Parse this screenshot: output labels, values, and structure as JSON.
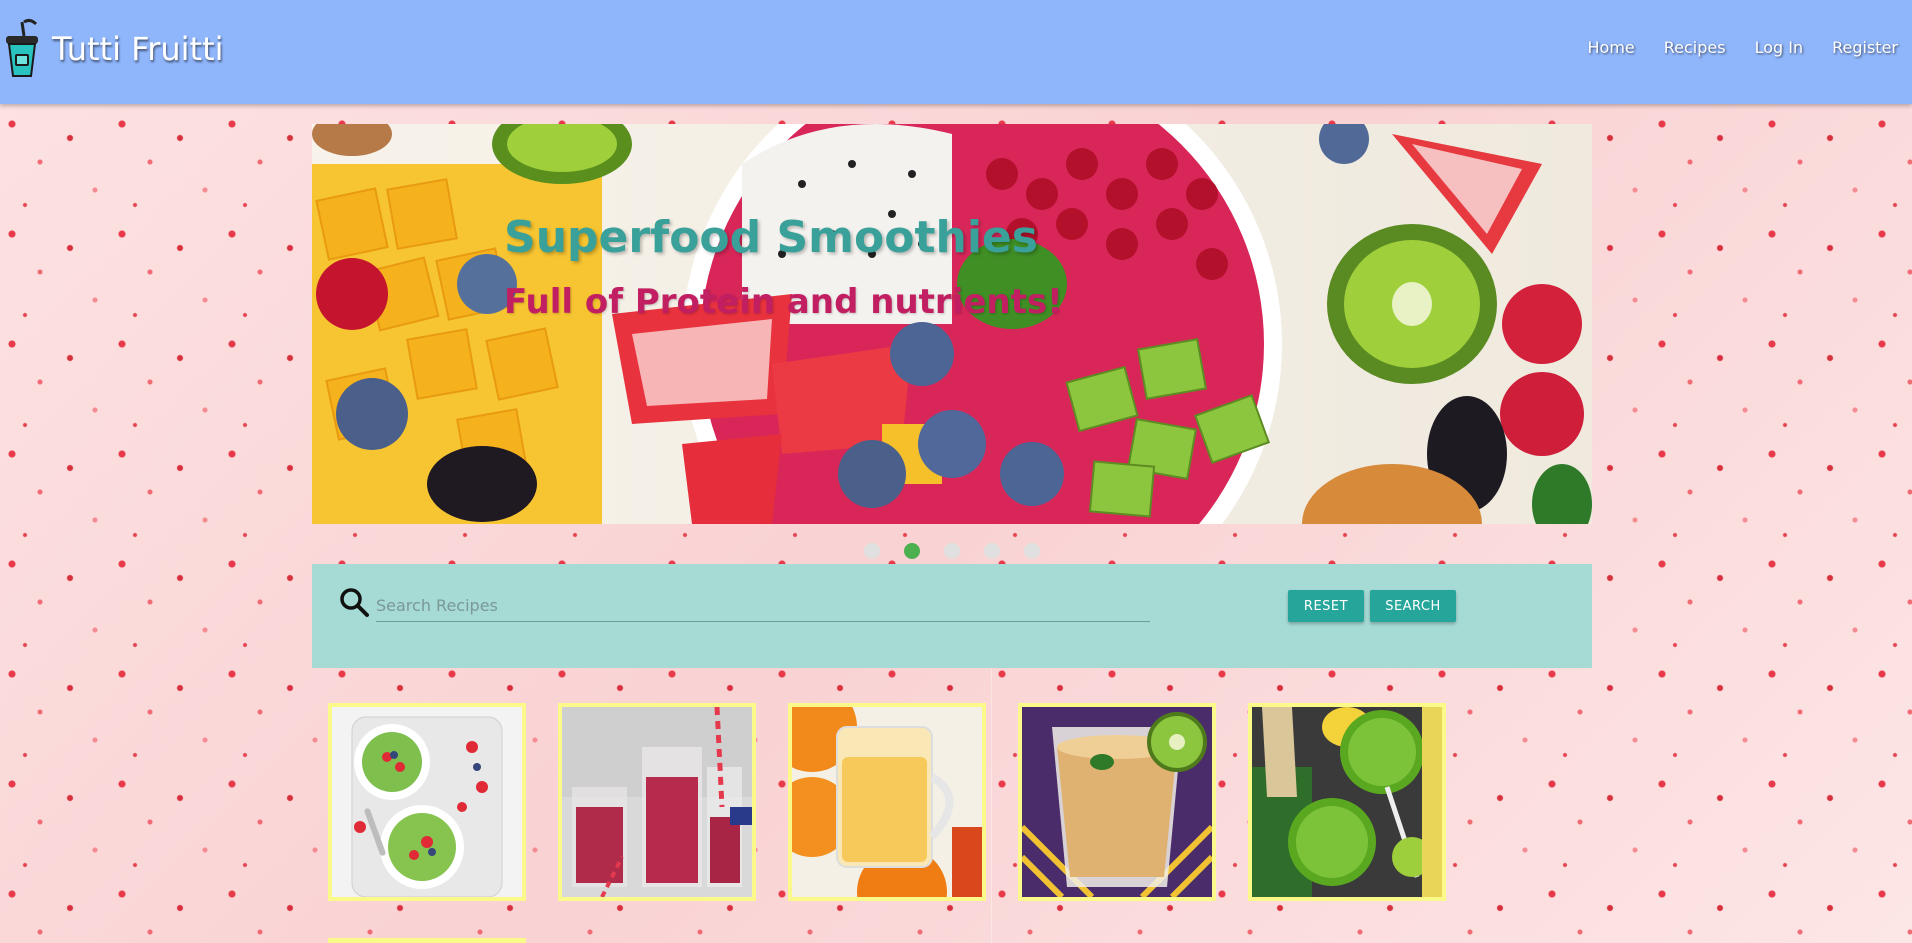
{
  "header": {
    "brand": "Tutti Fruitti",
    "logo_icon": "smoothie-cup-icon",
    "nav": [
      {
        "label": "Home"
      },
      {
        "label": "Recipes"
      },
      {
        "label": "Log In"
      },
      {
        "label": "Register"
      }
    ]
  },
  "hero": {
    "title": "Superfood Smoothies",
    "subtitle": "Full of Protein and nutrients!",
    "slide_count": 5,
    "active_slide": 2
  },
  "search": {
    "placeholder": "Search Recipes",
    "value": "",
    "reset_label": "RESET",
    "search_label": "SEARCH",
    "icon": "search-icon"
  },
  "recipes": [
    {
      "image": "green-smoothie-bowl-berries"
    },
    {
      "image": "berry-smoothie-glasses"
    },
    {
      "image": "orange-mango-smoothie-mug"
    },
    {
      "image": "kiwi-banana-smoothie-glass"
    },
    {
      "image": "green-ginger-smoothie"
    }
  ],
  "colors": {
    "header": "#8fb5fb",
    "accent": "#26a69a",
    "search_panel": "#a6dad5",
    "card_border": "#fbf98a",
    "hero_title": "#3aa19a",
    "hero_subtitle": "#c21f62",
    "dot_active": "#4caf50"
  }
}
